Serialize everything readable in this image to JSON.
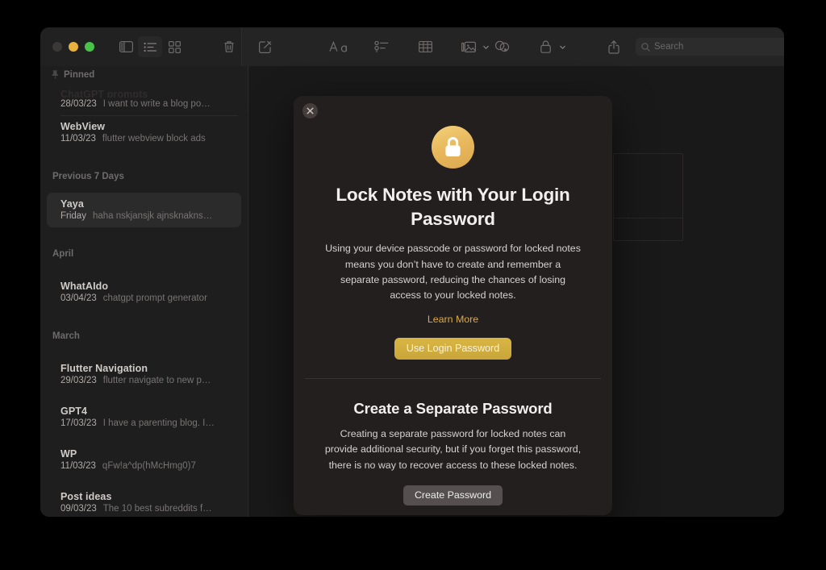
{
  "window": {
    "traffic_lights": [
      "close",
      "minimize",
      "maximize"
    ]
  },
  "toolbar": {
    "icons_left": [
      {
        "name": "sidebar-toggle-icon",
        "label": "Toggle Sidebar"
      },
      {
        "name": "list-view-icon",
        "label": "List View"
      },
      {
        "name": "gallery-view-icon",
        "label": "Gallery View"
      },
      {
        "name": "delete-note-icon",
        "label": "Delete Note"
      }
    ],
    "icons_right": [
      {
        "name": "compose-note-icon",
        "label": "New Note"
      },
      {
        "name": "format-text-icon",
        "label": "Aa"
      },
      {
        "name": "checklist-icon",
        "label": "Checklist"
      },
      {
        "name": "table-icon",
        "label": "Table"
      },
      {
        "name": "media-icon",
        "label": "Media"
      },
      {
        "name": "share-collaborate-icon",
        "label": "Collaborate"
      },
      {
        "name": "lock-note-icon",
        "label": "Lock Note"
      },
      {
        "name": "share-icon",
        "label": "Share"
      }
    ],
    "search": {
      "placeholder": "Search",
      "value": ""
    }
  },
  "sidebar": {
    "groups": [
      {
        "label": "Pinned",
        "icon": "pin-icon",
        "notes": [
          {
            "title": "ChatGPT prompts",
            "date": "28/03/23",
            "snippet": "I want to write a blog po…",
            "selected": false,
            "clipped": true
          },
          {
            "title": "WebView",
            "date": "11/03/23",
            "snippet": "flutter webview block ads",
            "selected": false,
            "clipped": false
          }
        ]
      },
      {
        "label": "Previous 7 Days",
        "icon": "",
        "notes": [
          {
            "title": "Yaya",
            "date": "Friday",
            "snippet": "haha nskjansjk ajnsknakns…",
            "selected": true,
            "clipped": false
          }
        ]
      },
      {
        "label": "April",
        "icon": "",
        "notes": [
          {
            "title": "WhatAIdo",
            "date": "03/04/23",
            "snippet": "chatgpt prompt generator",
            "selected": false,
            "clipped": false
          }
        ]
      },
      {
        "label": "March",
        "icon": "",
        "notes": [
          {
            "title": "Flutter Navigation",
            "date": "29/03/23",
            "snippet": "flutter navigate to new p…",
            "selected": false,
            "clipped": false
          },
          {
            "title": "GPT4",
            "date": "17/03/23",
            "snippet": "I have a parenting blog. I…",
            "selected": false,
            "clipped": false
          },
          {
            "title": "WP",
            "date": "11/03/23",
            "snippet": "qFw!a^dp(hMcHmg0)7",
            "selected": false,
            "clipped": false
          },
          {
            "title": "Post ideas",
            "date": "09/03/23",
            "snippet": "The 10 best subreddits f…",
            "selected": false,
            "clipped": false
          }
        ]
      }
    ]
  },
  "dialog": {
    "close_label": "×",
    "icon": "lock-icon",
    "title": "Lock Notes with Your Login Password",
    "body": "Using your device passcode or password for locked notes means you don’t have to create and remember a separate password, reducing the chances of losing access to your locked notes.",
    "learn_more": "Learn More",
    "primary_button": "Use Login Password",
    "section2_title": "Create a Separate Password",
    "section2_body": "Creating a separate password for locked notes can provide additional security, but if you forget this password, there is no way to recover access to these locked notes.",
    "secondary_button": "Create Password"
  },
  "colors": {
    "accent_gold": "#d8a94a",
    "primary_button": "#c9a53a",
    "secondary_button": "#55504f",
    "window_bg": "#1c1b1b",
    "dialog_bg": "#241f1f",
    "page_bg": "#000000"
  }
}
